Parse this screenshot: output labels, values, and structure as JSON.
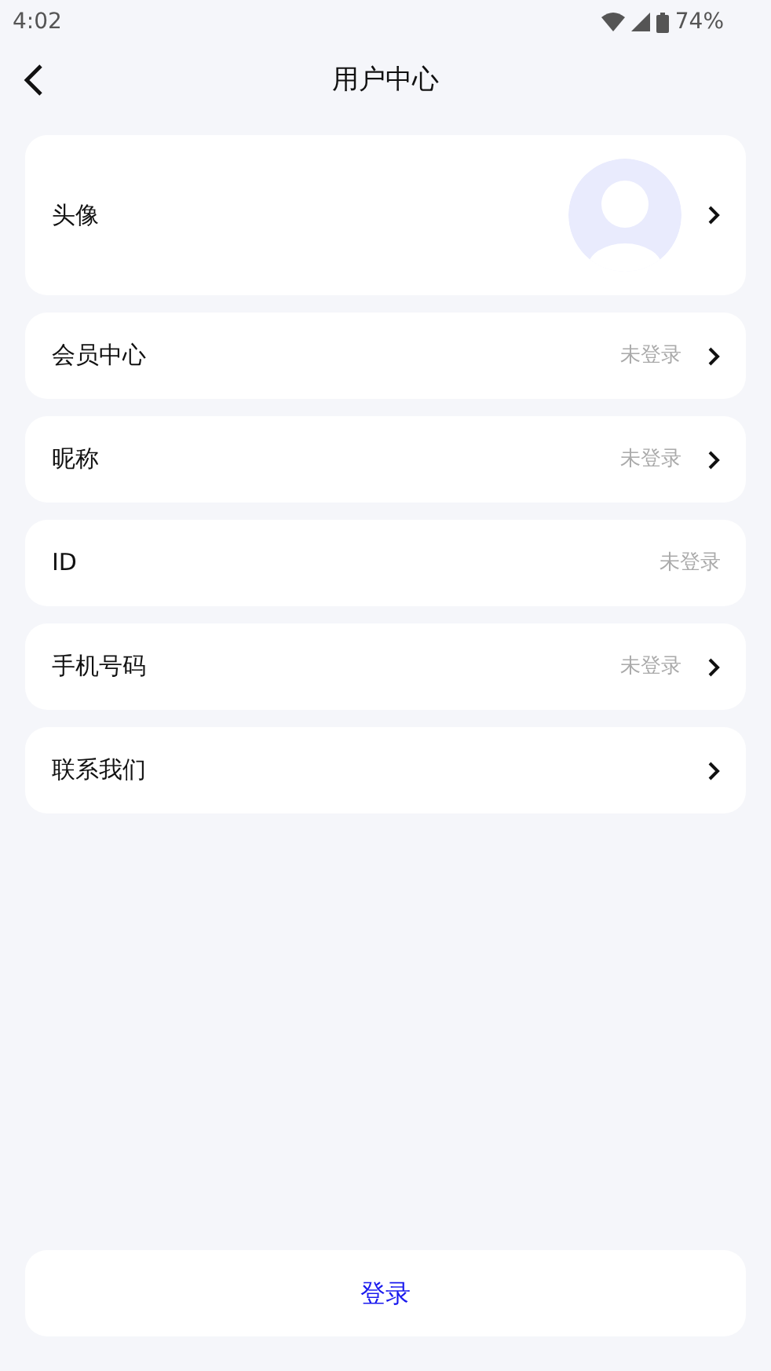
{
  "status_bar": {
    "time": "4:02",
    "battery": "74%"
  },
  "header": {
    "title": "用户中心"
  },
  "avatar_row": {
    "label": "头像",
    "has_arrow": true
  },
  "rows": [
    {
      "label": "会员中心",
      "value": "未登录",
      "has_arrow": true
    },
    {
      "label": "昵称",
      "value": "未登录",
      "has_arrow": true
    },
    {
      "label": "ID",
      "value": "未登录",
      "has_arrow": false
    },
    {
      "label": "手机号码",
      "value": "未登录",
      "has_arrow": true
    },
    {
      "label": "联系我们",
      "has_arrow": true
    }
  ],
  "login_button": "登录"
}
